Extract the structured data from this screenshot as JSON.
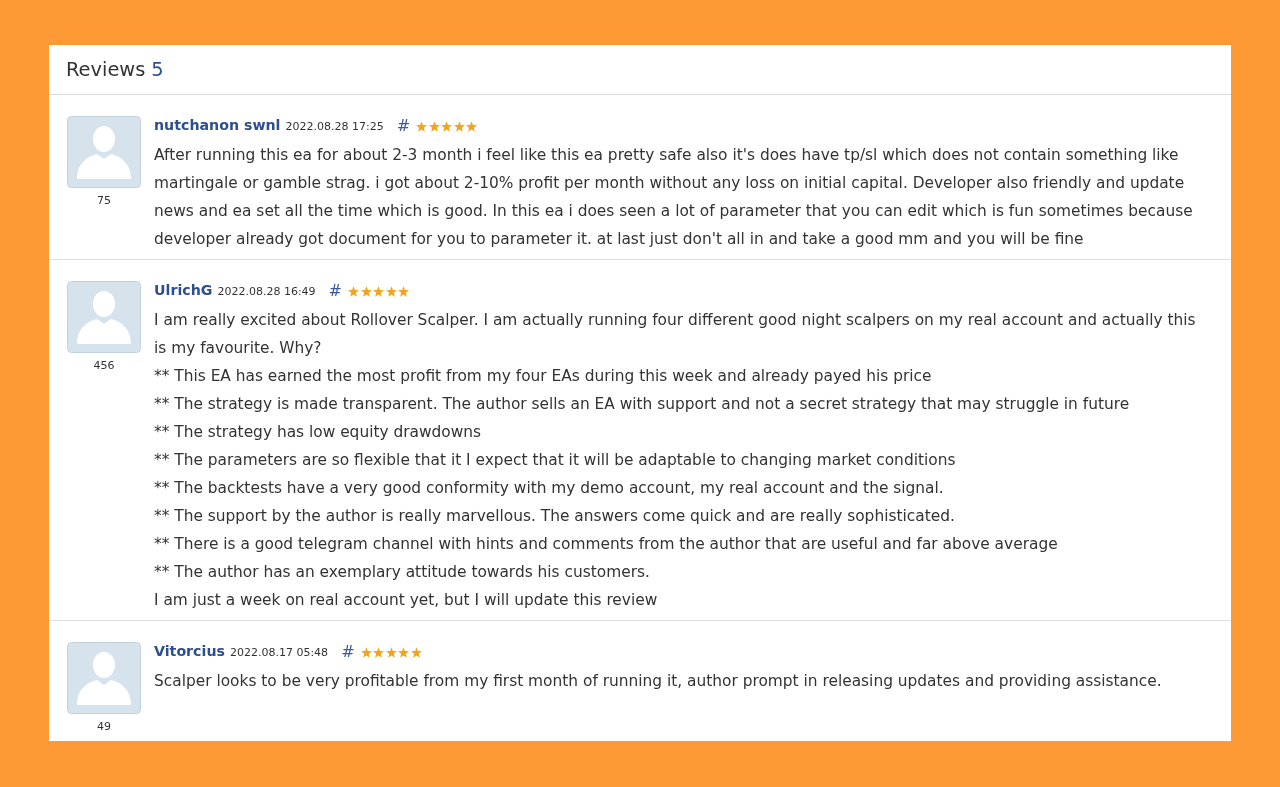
{
  "header": {
    "title": "Reviews",
    "count": "5"
  },
  "reviews": [
    {
      "author": "nutchanon swnl",
      "date": "2022.08.28 17:25",
      "link": "#",
      "stars": 5,
      "avatar_number": "75",
      "paragraphs": [
        "After running this ea for about 2-3 month i feel like this ea pretty safe also it's does have tp/sl which does not contain something like martingale or gamble strag. i got about 2-10% profit per month without any loss on initial capital. Developer also friendly and update news and ea set all the time which is good. In this ea i does seen a lot of parameter that you can edit which is fun sometimes because developer already got document for you to parameter it. at last just don't all in and take a good mm and you will be fine"
      ]
    },
    {
      "author": "UlrichG",
      "date": "2022.08.28 16:49",
      "link": "#",
      "stars": 5,
      "avatar_number": "456",
      "paragraphs": [
        "I am really excited about Rollover Scalper. I am actually running four different good night scalpers on my real account and actually this is my favourite. Why?",
        "** This EA has earned the most profit from my four EAs during this week and already payed his price",
        "** The strategy is made transparent. The author sells an EA with support and not a secret strategy that may struggle in future",
        "** The strategy has low equity drawdowns",
        "** The parameters are so flexible that it I expect that it will be adaptable to changing market conditions",
        "** The backtests have a very good conformity with my demo account, my real account and the signal.",
        "** The support by the author is really marvellous. The answers come quick and are really sophisticated.",
        "** There is a good telegram channel with hints and comments from the author that are useful and far above average",
        "** The author has an exemplary attitude towards his customers.",
        "I am just a week on real account yet, but I will update this review"
      ]
    },
    {
      "author": "Vitorcius",
      "date": "2022.08.17 05:48",
      "link": "#",
      "stars": 5,
      "avatar_number": "49",
      "paragraphs": [
        "Scalper looks to be very profitable from my first month of running it, author prompt in releasing updates and providing assistance."
      ]
    }
  ]
}
